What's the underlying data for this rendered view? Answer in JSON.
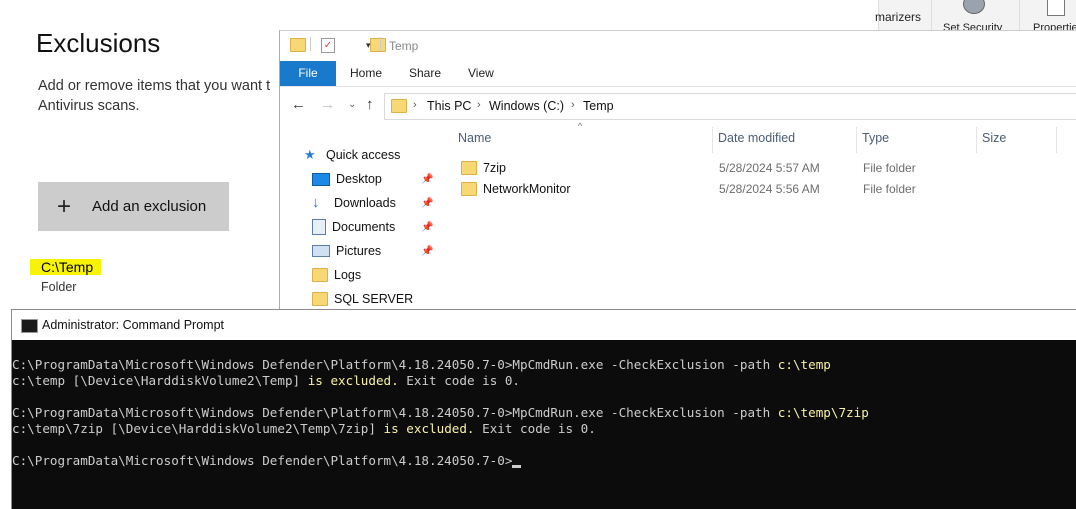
{
  "security": {
    "title": "Exclusions",
    "description": "Add or remove items that you want t\nAntivirus scans.",
    "add_button_label": "Add an exclusion",
    "exclusion_path": "C:\\Temp",
    "exclusion_type": "Folder"
  },
  "mmc_toolbar": {
    "item1": "marizers",
    "item2": "Set Security",
    "item3": "Propertie"
  },
  "explorer": {
    "window_title": "Temp",
    "ribbon_tabs": [
      "File",
      "Home",
      "Share",
      "View"
    ],
    "breadcrumb": [
      "This PC",
      "Windows (C:)",
      "Temp"
    ],
    "nav_items": [
      {
        "label": "Quick access",
        "icon": "star-icon"
      },
      {
        "label": "Desktop",
        "icon": "desktop-icon"
      },
      {
        "label": "Downloads",
        "icon": "downloads-icon"
      },
      {
        "label": "Documents",
        "icon": "documents-icon"
      },
      {
        "label": "Pictures",
        "icon": "pictures-icon"
      },
      {
        "label": "Logs",
        "icon": "folder-icon"
      },
      {
        "label": "SQL SERVER",
        "icon": "folder-icon"
      }
    ],
    "columns": [
      "Name",
      "Date modified",
      "Type",
      "Size"
    ],
    "files": [
      {
        "name": "7zip",
        "date": "5/28/2024 5:57 AM",
        "type": "File folder"
      },
      {
        "name": "NetworkMonitor",
        "date": "5/28/2024 5:56 AM",
        "type": "File folder"
      }
    ]
  },
  "cmd": {
    "title": "Administrator: Command Prompt",
    "prompt": "C:\\ProgramData\\Microsoft\\Windows Defender\\Platform\\4.18.24050.7-0>",
    "cmd1": "MpCmdRun.exe -CheckExclusion -path ",
    "cmd1_arg": "c:\\temp",
    "out1_path": "c:\\temp [\\Device\\HarddiskVolume2\\Temp] ",
    "out_excluded": "is excluded.",
    "out_exit": " Exit code is 0.",
    "cmd2": "MpCmdRun.exe -CheckExclusion -path ",
    "cmd2_arg": "c:\\temp\\7zip",
    "out2_path": "c:\\temp\\7zip [\\Device\\HarddiskVolume2\\Temp\\7zip] "
  },
  "colors": {
    "highlight": "#f7f206",
    "file_tab": "#1979ca",
    "console_bg": "#0c0c0c",
    "console_yellow": "#f9f1a5"
  }
}
